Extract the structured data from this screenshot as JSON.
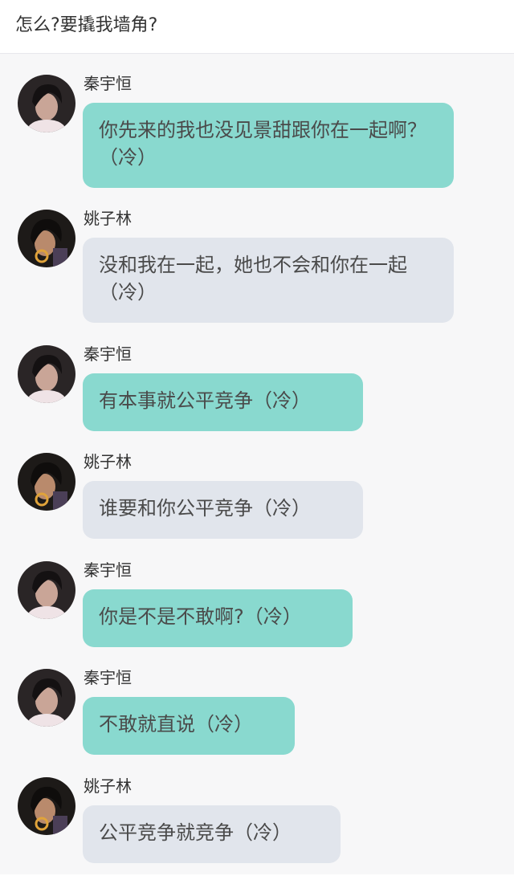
{
  "header": {
    "title": "怎么?要撬我墙角?"
  },
  "messages": [
    {
      "name": "秦宇恒",
      "text": "你先来的我也没见景甜跟你在一起啊？（冷）",
      "style": "teal",
      "avatar": "avatar-qin"
    },
    {
      "name": "姚子林",
      "text": "没和我在一起，她也不会和你在一起（冷）",
      "style": "grey",
      "avatar": "avatar-yao"
    },
    {
      "name": "秦宇恒",
      "text": "有本事就公平竞争（冷）",
      "style": "teal",
      "avatar": "avatar-qin"
    },
    {
      "name": "姚子林",
      "text": "谁要和你公平竞争（冷）",
      "style": "grey",
      "avatar": "avatar-yao"
    },
    {
      "name": "秦宇恒",
      "text": "你是不是不敢啊?（冷）",
      "style": "teal",
      "avatar": "avatar-qin"
    },
    {
      "name": "秦宇恒",
      "text": "不敢就直说（冷）",
      "style": "teal",
      "avatar": "avatar-qin"
    },
    {
      "name": "姚子林",
      "text": "公平竞争就竞争（冷）",
      "style": "grey",
      "avatar": "avatar-yao"
    }
  ],
  "colors": {
    "bubble_teal": "#89d9cf",
    "bubble_grey": "#e1e5ec",
    "text": "#4a4a4a"
  }
}
